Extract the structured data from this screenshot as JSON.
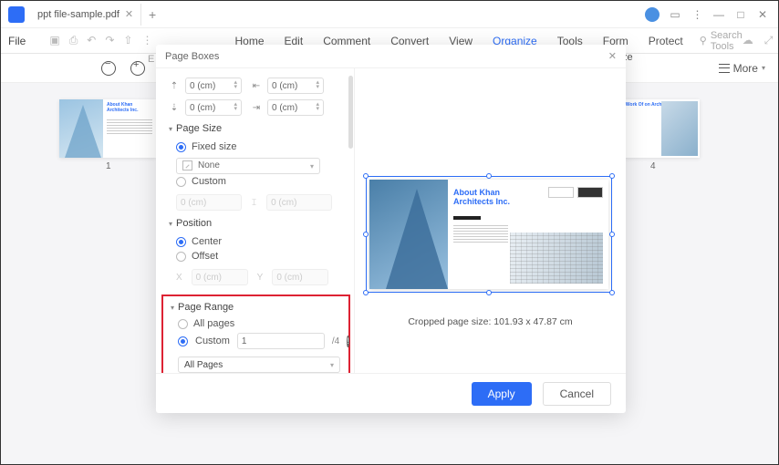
{
  "titlebar": {
    "tab_name": "ppt file-sample.pdf"
  },
  "menubar": {
    "file": "File",
    "items": [
      "Home",
      "Edit",
      "Comment",
      "Convert",
      "View",
      "Organize",
      "Tools",
      "Form",
      "Protect"
    ],
    "active_index": 5,
    "search_placeholder": "Search Tools"
  },
  "toolbar": {
    "more_label": "More",
    "edit_cut": "E",
    "re_cut": "ze"
  },
  "thumbs": {
    "t1_title": "About Khan\nArchitects Inc.",
    "t1_num": "1",
    "t4_title": "he New Work Of\non Architects Inc.",
    "t4_num": "4"
  },
  "dialog": {
    "title": "Page Boxes",
    "margins": {
      "top": "0 (cm)",
      "bottom": "0 (cm)",
      "left": "0 (cm)",
      "right": "0 (cm)"
    },
    "page_size": {
      "header": "Page Size",
      "fixed_label": "Fixed size",
      "none": "None",
      "custom_label": "Custom",
      "dw": "0 (cm)",
      "dh": "0 (cm)"
    },
    "position": {
      "header": "Position",
      "center": "Center",
      "offset": "Offset",
      "dx": "0 (cm)",
      "dy": "0 (cm)"
    },
    "page_range": {
      "header": "Page Range",
      "all_label": "All pages",
      "custom_label": "Custom",
      "custom_value": "1",
      "total_suffix": "/4",
      "subset": "All Pages"
    },
    "preview": {
      "title": "About Khan\nArchitects Inc."
    },
    "crop_info": "Cropped page size: 101.93 x 47.87 cm",
    "buttons": {
      "apply": "Apply",
      "cancel": "Cancel"
    }
  }
}
